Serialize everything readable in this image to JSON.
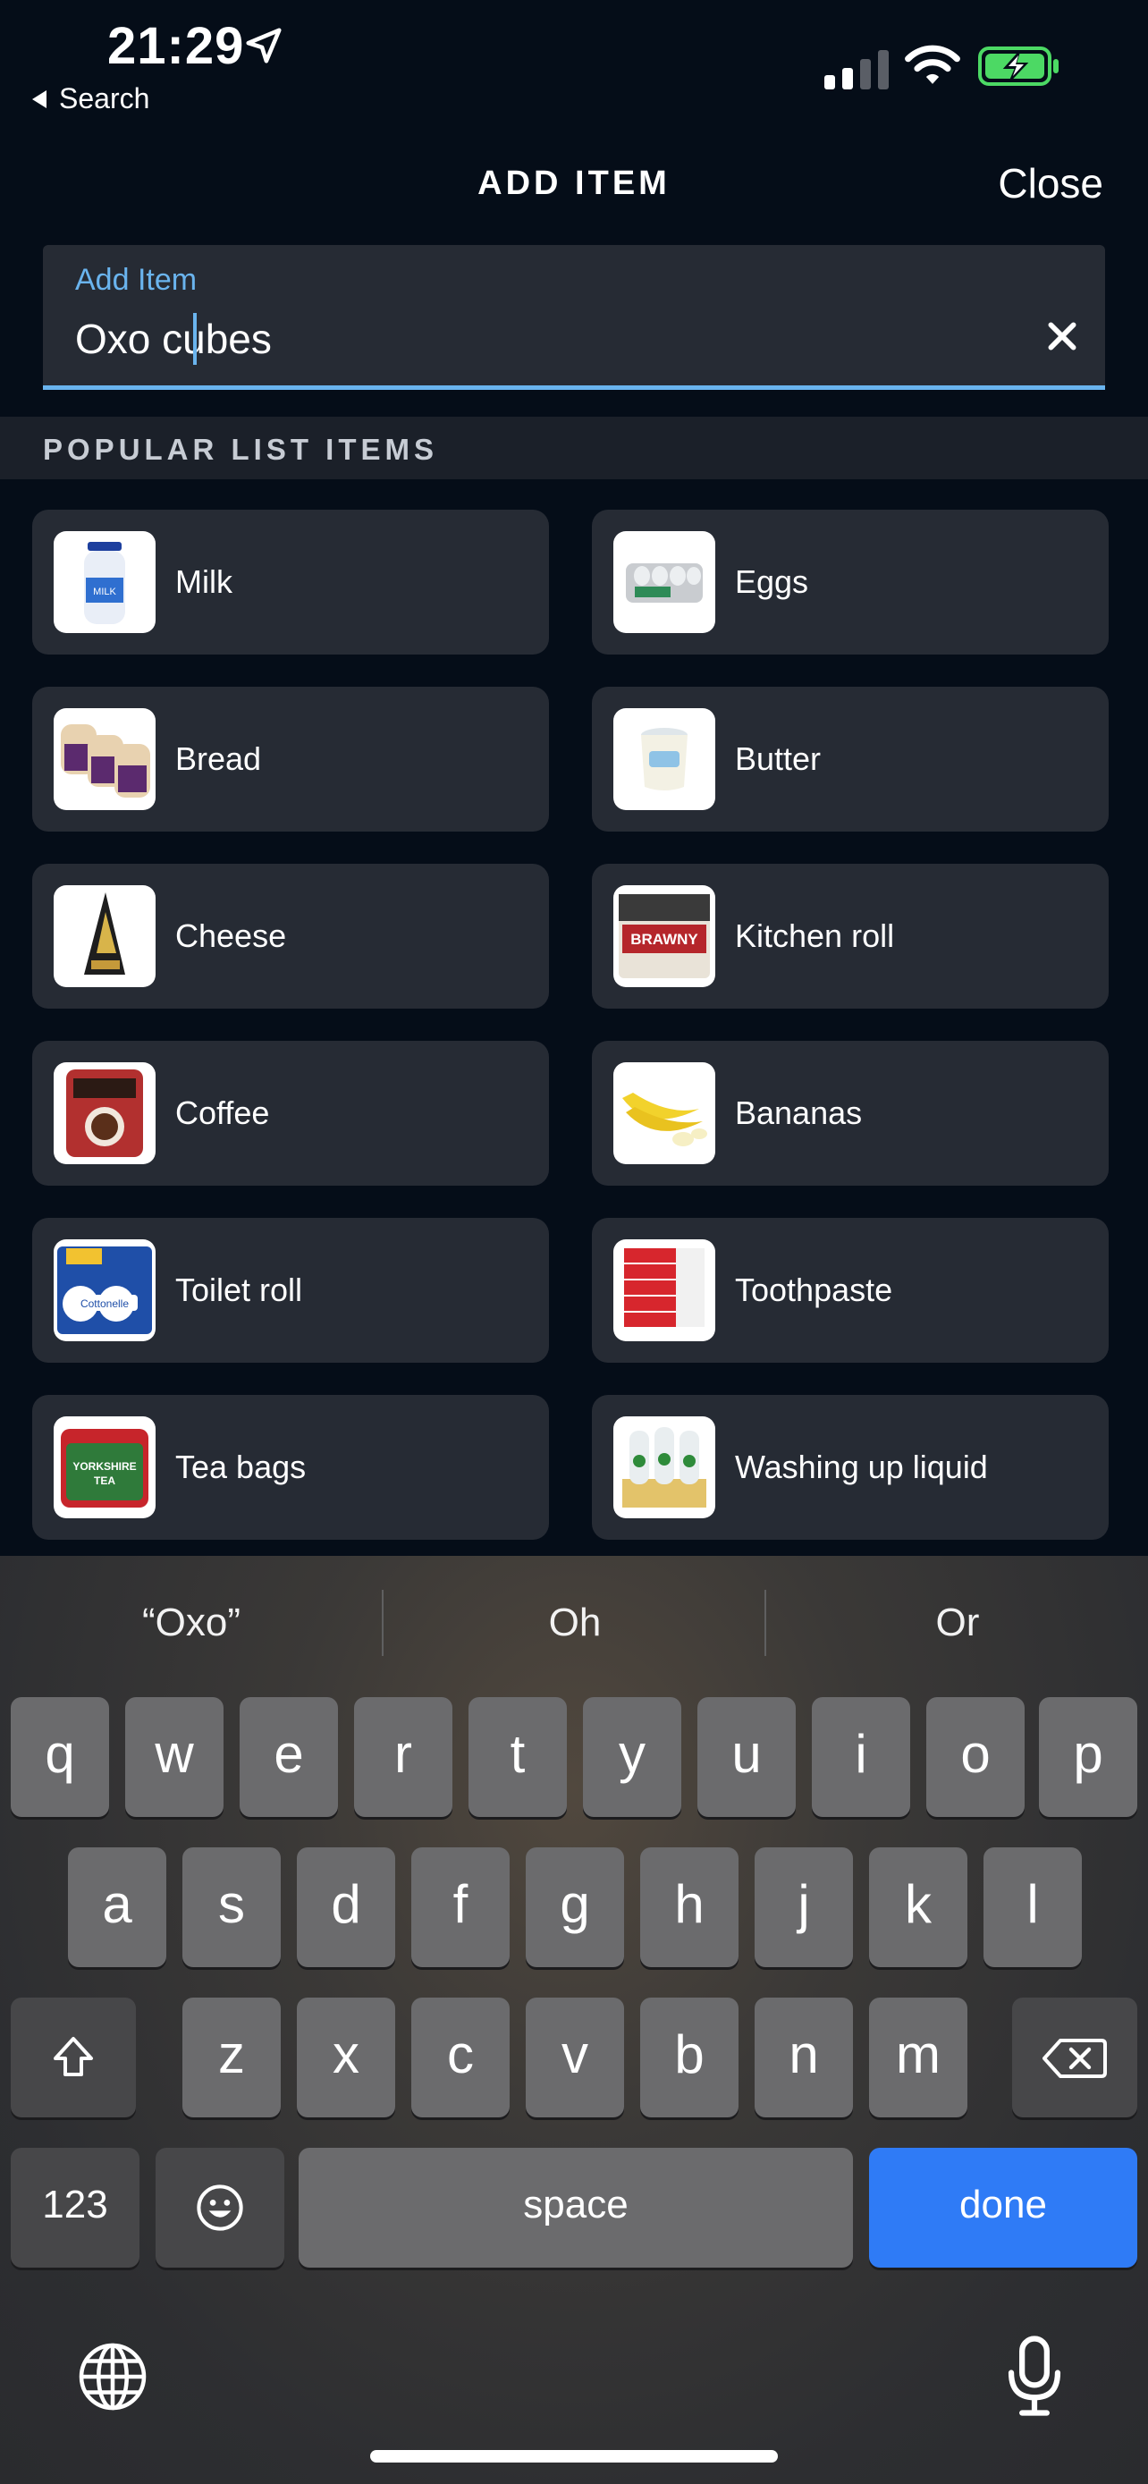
{
  "status_bar": {
    "time": "21:29",
    "back_label": "Search"
  },
  "header": {
    "title": "ADD ITEM",
    "close_label": "Close"
  },
  "add_item": {
    "label": "Add Item",
    "value": "Oxo cubes"
  },
  "popular": {
    "title": "POPULAR LIST ITEMS",
    "items": [
      {
        "label": "Milk",
        "icon": "milk-image"
      },
      {
        "label": "Eggs",
        "icon": "eggs-image"
      },
      {
        "label": "Bread",
        "icon": "bread-image"
      },
      {
        "label": "Butter",
        "icon": "butter-image"
      },
      {
        "label": "Cheese",
        "icon": "cheese-image"
      },
      {
        "label": "Kitchen roll",
        "icon": "kitchen-roll-image"
      },
      {
        "label": "Coffee",
        "icon": "coffee-image"
      },
      {
        "label": "Bananas",
        "icon": "bananas-image"
      },
      {
        "label": "Toilet roll",
        "icon": "toilet-roll-image"
      },
      {
        "label": "Toothpaste",
        "icon": "toothpaste-image"
      },
      {
        "label": "Tea bags",
        "icon": "tea-bags-image"
      },
      {
        "label": "Washing up liquid",
        "icon": "washing-up-liquid-image"
      }
    ]
  },
  "keyboard": {
    "suggestions": [
      "“Oxo”",
      "Oh",
      "Or"
    ],
    "row1": [
      "q",
      "w",
      "e",
      "r",
      "t",
      "y",
      "u",
      "i",
      "o",
      "p"
    ],
    "row2": [
      "a",
      "s",
      "d",
      "f",
      "g",
      "h",
      "j",
      "k",
      "l"
    ],
    "row3": [
      "z",
      "x",
      "c",
      "v",
      "b",
      "n",
      "m"
    ],
    "numbers_label": "123",
    "space_label": "space",
    "done_label": "done"
  },
  "colors": {
    "accent": "#6ab4ee",
    "done_key": "#2f7bf6",
    "battery": "#4cd964",
    "background": "#050d18",
    "card": "#262b34"
  }
}
